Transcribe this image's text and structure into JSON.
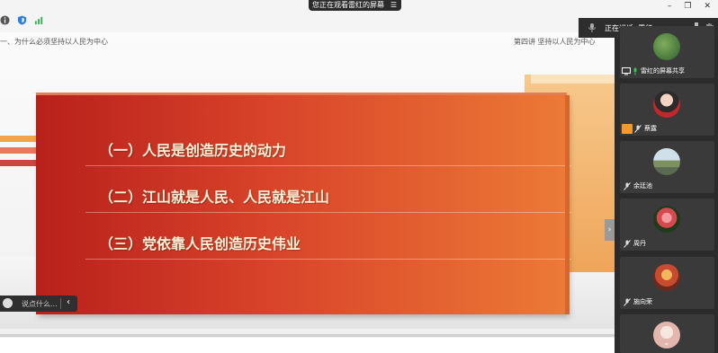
{
  "top_bar": {
    "viewing_label": "您正在观看雷红的屏幕",
    "menu_icon": "menu-icon",
    "window_controls": [
      "minimize-icon",
      "restore-icon",
      "close-icon"
    ]
  },
  "slide": {
    "header_left": "一、为什么必须坚持以人民为中心",
    "header_right": "第四讲  坚持以人民为中心",
    "items": [
      "（一）人民是创造历史的动力",
      "（二）江山就是人民、人民就是江山",
      "（三）党依靠人民创造历史伟业"
    ],
    "colors": {
      "panel_start": "#b8201b",
      "panel_end": "#ec7a36",
      "text": "#fff3d9"
    }
  },
  "comment_bar": {
    "placeholder": "说点什么...",
    "collapse_icon": "chevron-left-icon"
  },
  "right_panel": {
    "speaking_label": "正在讲话: 雷红;",
    "participants": [
      {
        "name": "雷红的屏幕共享"
      },
      {
        "name": "蔡露"
      },
      {
        "name": "余廷池"
      },
      {
        "name": "周丹"
      },
      {
        "name": "施向荣"
      }
    ],
    "scroll_icon": "chevron-down-icon"
  }
}
